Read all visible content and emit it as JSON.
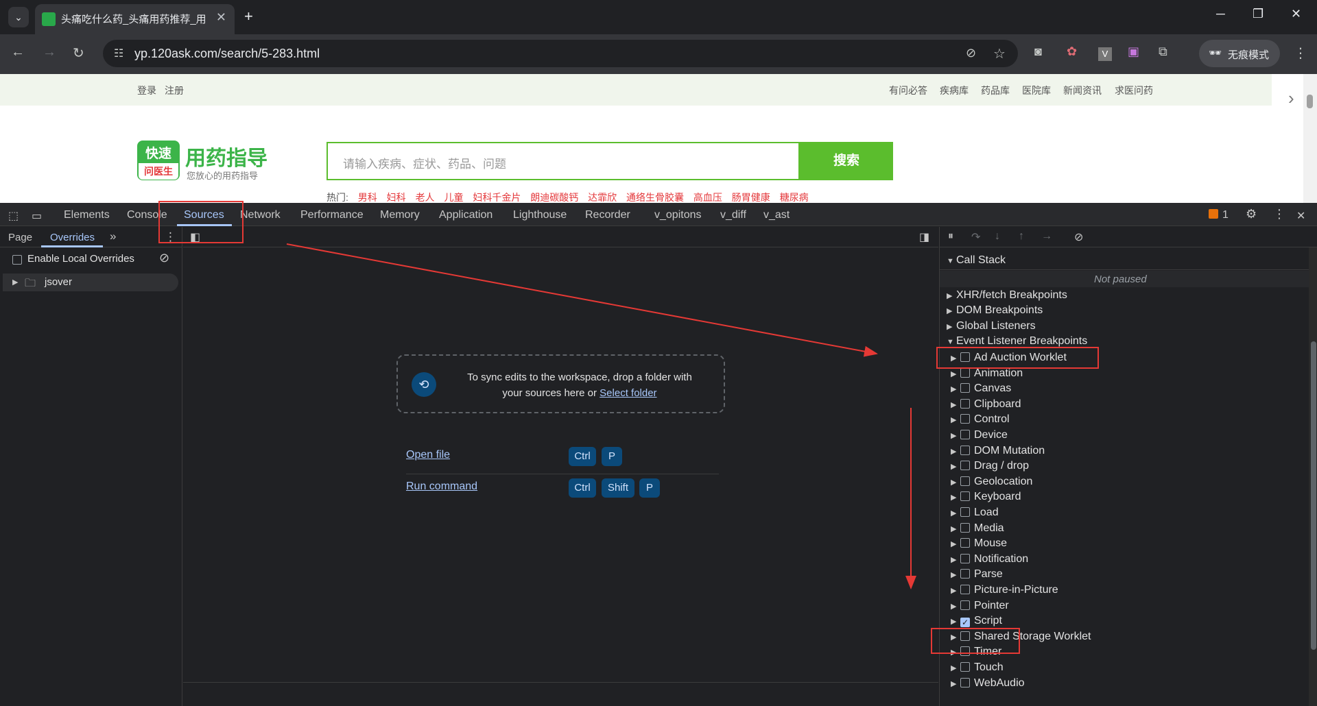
{
  "browser": {
    "tab_title": "头痛吃什么药_头痛用药推荐_用",
    "url": "yp.120ask.com/search/5-283.html",
    "incognito_label": "无痕模式"
  },
  "site": {
    "top_left_links": [
      "登录",
      "注册"
    ],
    "top_right_links": [
      "有问必答",
      "疾病库",
      "药品库",
      "医院库",
      "新闻资讯",
      "求医问药"
    ],
    "logo_badge_top": "快速",
    "logo_badge_bottom": "问医生",
    "logo_title": "用药指导",
    "logo_subtitle": "您放心的用药指导",
    "search_placeholder": "请输入疾病、症状、药品、问题",
    "search_button": "搜索",
    "hot_label": "热门:",
    "hot_words": [
      "男科",
      "妇科",
      "老人",
      "儿童",
      "妇科千金片",
      "朗迪碳酸钙",
      "达霏欣",
      "通络生骨胶囊",
      "高血压",
      "肠胃健康",
      "糖尿病"
    ]
  },
  "devtools": {
    "tabs": [
      "Elements",
      "Console",
      "Sources",
      "Network",
      "Performance",
      "Memory",
      "Application",
      "Lighthouse",
      "Recorder",
      "v_opitons",
      "v_diff",
      "v_ast"
    ],
    "active_tab": "Sources",
    "issues_count": "1",
    "nav_tabs": [
      "Page",
      "Overrides"
    ],
    "active_nav_tab": "Overrides",
    "enable_overrides_label": "Enable Local Overrides",
    "folder_name": "jsover",
    "dropzone_text_1": "To sync edits to the workspace, drop a folder with",
    "dropzone_text_2": "your sources here or",
    "dropzone_link": "Select folder",
    "shortcuts": [
      {
        "label": "Open file",
        "keys": [
          "Ctrl",
          "P"
        ]
      },
      {
        "label": "Run command",
        "keys": [
          "Ctrl",
          "Shift",
          "P"
        ]
      }
    ],
    "call_stack_label": "Call Stack",
    "not_paused": "Not paused",
    "sections": [
      "XHR/fetch Breakpoints",
      "DOM Breakpoints",
      "Global Listeners",
      "Event Listener Breakpoints"
    ],
    "event_categories": [
      {
        "name": "Ad Auction Worklet",
        "checked": false
      },
      {
        "name": "Animation",
        "checked": false
      },
      {
        "name": "Canvas",
        "checked": false
      },
      {
        "name": "Clipboard",
        "checked": false
      },
      {
        "name": "Control",
        "checked": false
      },
      {
        "name": "Device",
        "checked": false
      },
      {
        "name": "DOM Mutation",
        "checked": false
      },
      {
        "name": "Drag / drop",
        "checked": false
      },
      {
        "name": "Geolocation",
        "checked": false
      },
      {
        "name": "Keyboard",
        "checked": false
      },
      {
        "name": "Load",
        "checked": false
      },
      {
        "name": "Media",
        "checked": false
      },
      {
        "name": "Mouse",
        "checked": false
      },
      {
        "name": "Notification",
        "checked": false
      },
      {
        "name": "Parse",
        "checked": false
      },
      {
        "name": "Picture-in-Picture",
        "checked": false
      },
      {
        "name": "Pointer",
        "checked": false
      },
      {
        "name": "Script",
        "checked": true
      },
      {
        "name": "Shared Storage Worklet",
        "checked": false
      },
      {
        "name": "Timer",
        "checked": false
      },
      {
        "name": "Touch",
        "checked": false
      },
      {
        "name": "WebAudio",
        "checked": false
      }
    ]
  },
  "colors": {
    "accent": "#a8c7fa",
    "annotation_red": "#e53935",
    "site_green": "#5bbd2d"
  }
}
